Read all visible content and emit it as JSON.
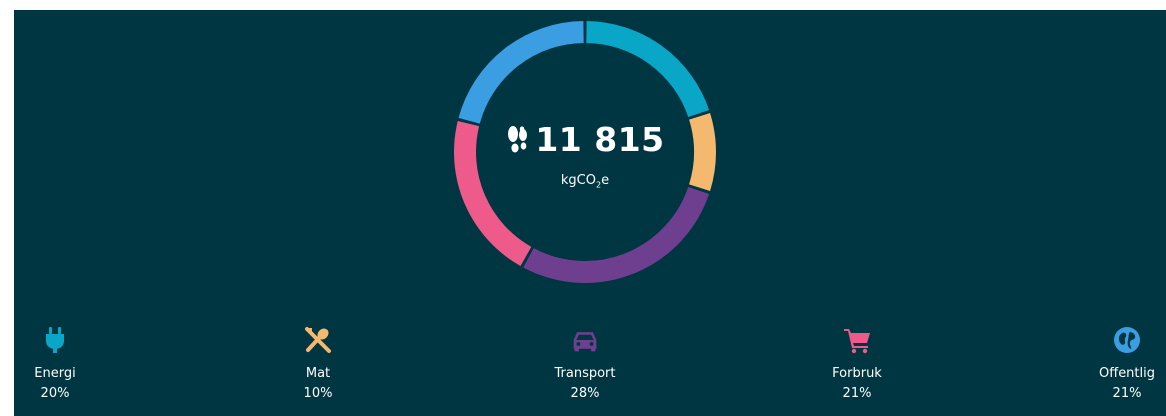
{
  "total": {
    "value": "11 815",
    "unit_prefix": "kgCO",
    "unit_sub": "2",
    "unit_suffix": "e"
  },
  "colors": {
    "background": "#003642",
    "energi": "#0aa6c8",
    "mat": "#f4b86e",
    "transport": "#6e3f8e",
    "forbruk": "#ee5a8a",
    "offentlig": "#3b9ee2"
  },
  "categories": [
    {
      "key": "energi",
      "label": "Energi",
      "value": "20%",
      "icon": "plug-icon",
      "share": 20
    },
    {
      "key": "mat",
      "label": "Mat",
      "value": "10%",
      "icon": "utensils-icon",
      "share": 10
    },
    {
      "key": "transport",
      "label": "Transport",
      "value": "28%",
      "icon": "car-icon",
      "share": 28
    },
    {
      "key": "forbruk",
      "label": "Forbruk",
      "value": "21%",
      "icon": "shopping-cart-icon",
      "share": 21
    },
    {
      "key": "offentlig",
      "label": "Offentlig",
      "value": "21%",
      "icon": "globe-icon",
      "share": 21
    }
  ]
}
